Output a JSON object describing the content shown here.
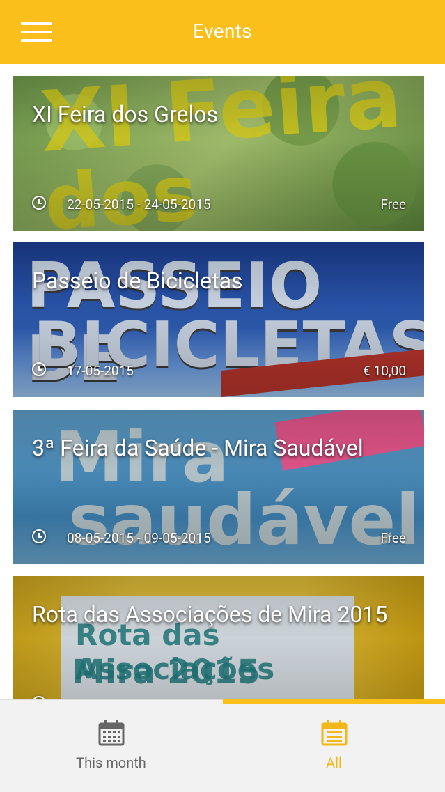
{
  "app": {
    "title": "Events",
    "accent": "#fbbf1c"
  },
  "events": [
    {
      "title": "XI Feira dos Grelos",
      "date": "22-05-2015 - 24-05-2015",
      "price": "Free"
    },
    {
      "title": "Passeio de Bicicletas",
      "date": "17-05-2015",
      "price": "€ 10,00"
    },
    {
      "title": "3ª Feira da Saúde - Mira Saudável",
      "date": "08-05-2015 - 09-05-2015",
      "price": "Free"
    },
    {
      "title": "Rota das Associações de Mira 2015",
      "date": "",
      "price": ""
    }
  ],
  "tabs": [
    {
      "label": "This month",
      "icon": "calendar-grid-icon",
      "selected": false
    },
    {
      "label": "All",
      "icon": "calendar-list-icon",
      "selected": true
    }
  ]
}
